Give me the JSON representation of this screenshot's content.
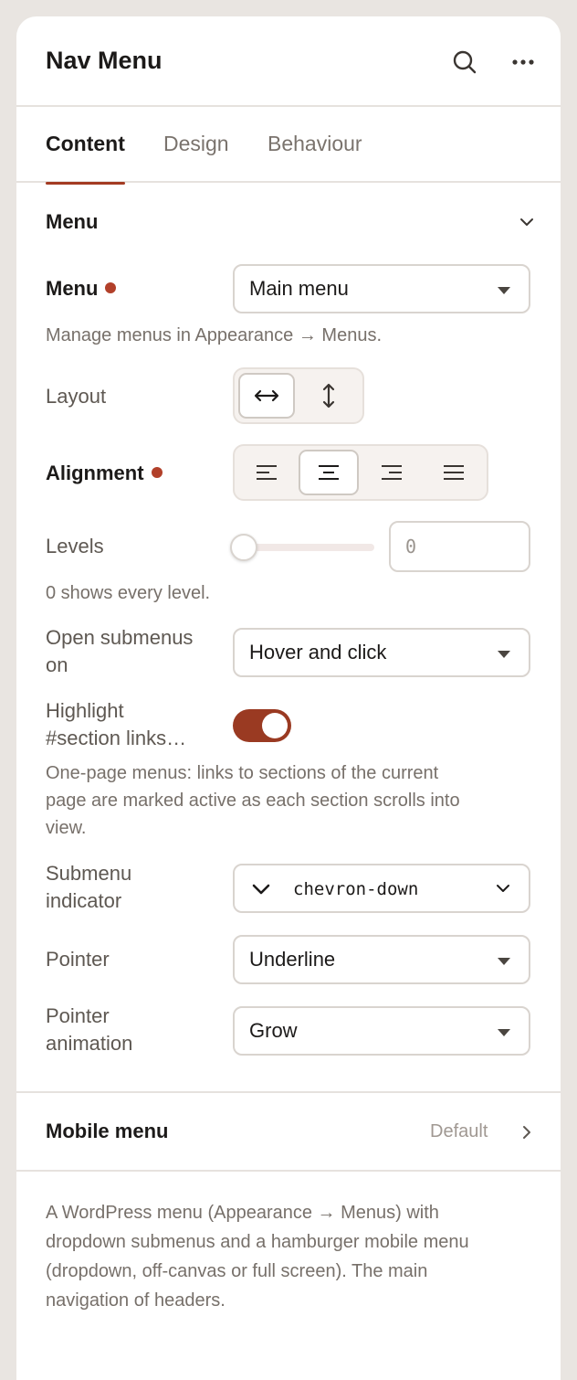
{
  "header": {
    "title": "Nav Menu"
  },
  "tabs": [
    {
      "label": "Content",
      "active": true
    },
    {
      "label": "Design",
      "active": false
    },
    {
      "label": "Behaviour",
      "active": false
    }
  ],
  "section": {
    "title": "Menu"
  },
  "fields": {
    "menu": {
      "label": "Menu",
      "value": "Main menu",
      "help": "Manage menus in Appearance → Menus."
    },
    "layout": {
      "label": "Layout",
      "options": [
        "horizontal-arrows-icon",
        "vertical-arrows-icon"
      ],
      "selected": 0
    },
    "alignment": {
      "label": "Alignment",
      "options": [
        "align-left-icon",
        "align-center-icon",
        "align-right-icon",
        "align-justify-icon"
      ],
      "selected": 1
    },
    "levels": {
      "label": "Levels",
      "value": "0",
      "help": "0 shows every level."
    },
    "open_submenus": {
      "label_line1": "Open submenus",
      "label_line2": "on",
      "value": "Hover and click"
    },
    "highlight": {
      "label_line1": "Highlight",
      "label_line2": "#section links…",
      "on": true,
      "help_line1": "One-page menus: links to sections of the current",
      "help_line2": "page are marked active as each section scrolls into",
      "help_line3": "view."
    },
    "submenu_indicator": {
      "label_line1": "Submenu",
      "label_line2": "indicator",
      "value": "chevron-down",
      "icon": "chevron-down-icon"
    },
    "pointer": {
      "label": "Pointer",
      "value": "Underline"
    },
    "pointer_animation": {
      "label_line1": "Pointer",
      "label_line2": "animation",
      "value": "Grow"
    }
  },
  "mobile_menu": {
    "label": "Mobile menu",
    "value": "Default"
  },
  "description": {
    "line1": "A WordPress menu (Appearance → Menus) with",
    "line2": "dropdown submenus and a hamburger mobile menu",
    "line3": "(dropdown, off-canvas or full screen). The main",
    "line4": "navigation of headers."
  },
  "colors": {
    "accent": "#a33b22",
    "toggle_on": "#9a3a22",
    "required_dot": "#b2402a"
  }
}
